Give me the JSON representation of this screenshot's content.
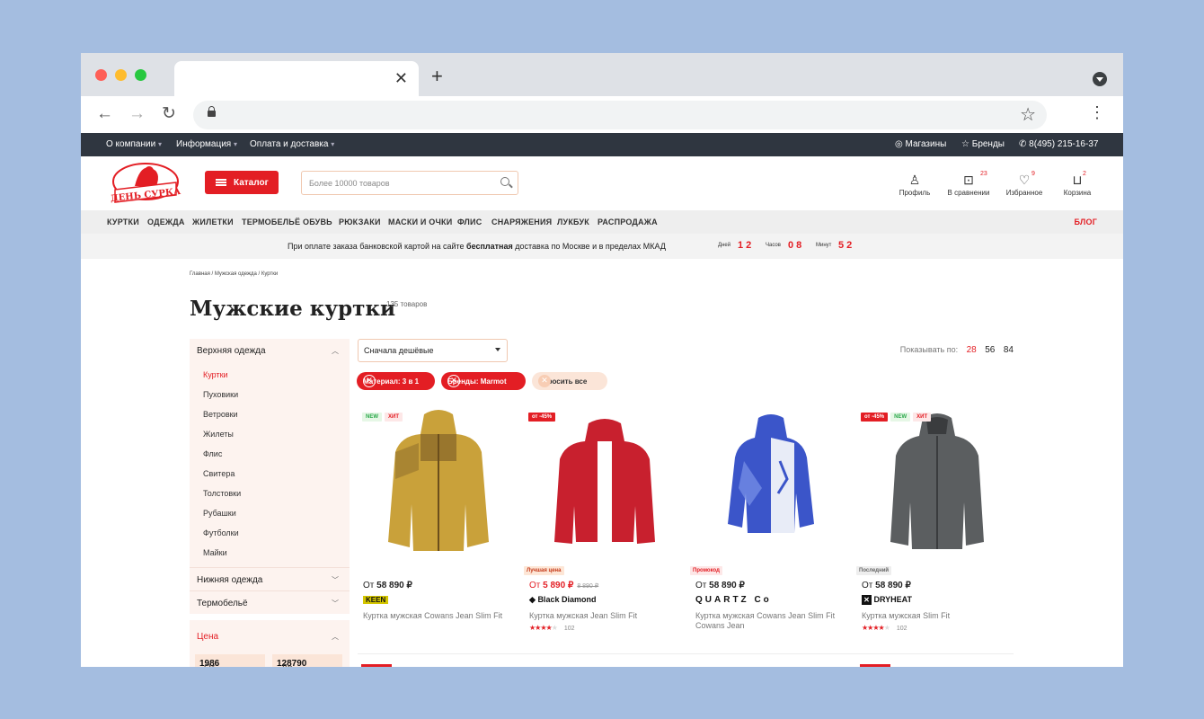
{
  "topbar": {
    "links": [
      "О компании",
      "Информация",
      "Оплата и доставка"
    ],
    "stores": "Магазины",
    "brands": "Бренды",
    "phone": "8(495) 215-16-37"
  },
  "header": {
    "logo_text": "ДЕНЬ СУРКА",
    "catalog_label": "Каталог",
    "search_placeholder": "Более 10000 товаров",
    "icons": [
      {
        "label": "Профиль",
        "count": "",
        "icon": "user-icon"
      },
      {
        "label": "В сравнении",
        "count": "23",
        "icon": "compare-icon"
      },
      {
        "label": "Избранное",
        "count": "9",
        "icon": "heart-icon"
      },
      {
        "label": "Корзина",
        "count": "2",
        "icon": "cart-icon"
      }
    ]
  },
  "menu": {
    "items": [
      "КУРТКИ",
      "ОДЕЖДА",
      "ЖИЛЕТКИ",
      "ТЕРМОБЕЛЬЁ",
      "ОБУВЬ",
      "РЮКЗАКИ",
      "МАСКИ И ОЧКИ",
      "ФЛИС",
      "СНАРЯЖЕНИЯ",
      "ЛУКБУК",
      "РАСПРОДАЖА"
    ],
    "blog": "БЛОГ"
  },
  "promo": {
    "text_before": "При оплате заказа банковской картой на сайте ",
    "text_bold": "бесплатная",
    "text_after": " доставка по Москве и в пределах МКАД",
    "days_label": "Дней",
    "days": "1 2",
    "hours_label": "Часов",
    "hours": "0 8",
    "minutes_label": "Минут",
    "minutes": "5 2"
  },
  "breadcrumb": "Главная  /  Мужская одежда / Куртки",
  "page": {
    "title": "Мужские куртки",
    "count": "135 товаров"
  },
  "sidebar": {
    "group": "Верхняя одежда",
    "items": [
      "Куртки",
      "Пуховики",
      "Ветровки",
      "Жилеты",
      "Флис",
      "Свитера",
      "Толстовки",
      "Рубашки",
      "Футболки",
      "Майки"
    ],
    "active": "Куртки",
    "other_groups": [
      "Нижняя одежда",
      "Термобельё"
    ],
    "price_title": "Цена",
    "price_from_label": "От",
    "price_from": "1986",
    "price_to_label": "До",
    "price_to": "128790"
  },
  "sort": {
    "selected": "Сначала дешёвые"
  },
  "perpage": {
    "label": "Показывать по:",
    "options": [
      "28",
      "56",
      "84"
    ],
    "selected": "28"
  },
  "filters": {
    "chips": [
      "Материал: 3 в 1",
      "Бренды: Marmot"
    ],
    "reset": "Сбросить все"
  },
  "products": [
    {
      "badges": [
        "NEW",
        "ХИТ"
      ],
      "tag": "",
      "price_prefix": "От",
      "price": "58 890 ₽",
      "old_price": "",
      "brand": "KEEN",
      "name": "Куртка мужская Cowans Jean Slim Fit",
      "rating": "★★★★",
      "reviews": "",
      "color": "#c9a13a"
    },
    {
      "badges": [
        "от -45%"
      ],
      "tag": "Лучшая цена",
      "price_prefix": "От",
      "price": "5 890 ₽",
      "old_price": "8 890 ₽",
      "brand": "Black Diamond",
      "name": "Куртка мужская Jean Slim Fit",
      "rating": "★★★★",
      "reviews": "102",
      "color": "#c8202e"
    },
    {
      "badges": [],
      "tag": "Промокод",
      "price_prefix": "От",
      "price": "58 890 ₽",
      "old_price": "",
      "brand": "QUARTZ Co",
      "name": "Куртка мужская Cowans Jean Slim Fit Cowans Jean",
      "rating": "",
      "reviews": "",
      "color": "#3b55c9"
    },
    {
      "badges": [
        "от -45%",
        "NEW",
        "ХИТ"
      ],
      "tag": "Последний",
      "price_prefix": "От",
      "price": "58 890 ₽",
      "old_price": "",
      "brand": "DRYHEAT",
      "name": "Куртка мужская Slim Fit",
      "rating": "★★★★",
      "reviews": "102",
      "color": "#5b5e60"
    }
  ]
}
